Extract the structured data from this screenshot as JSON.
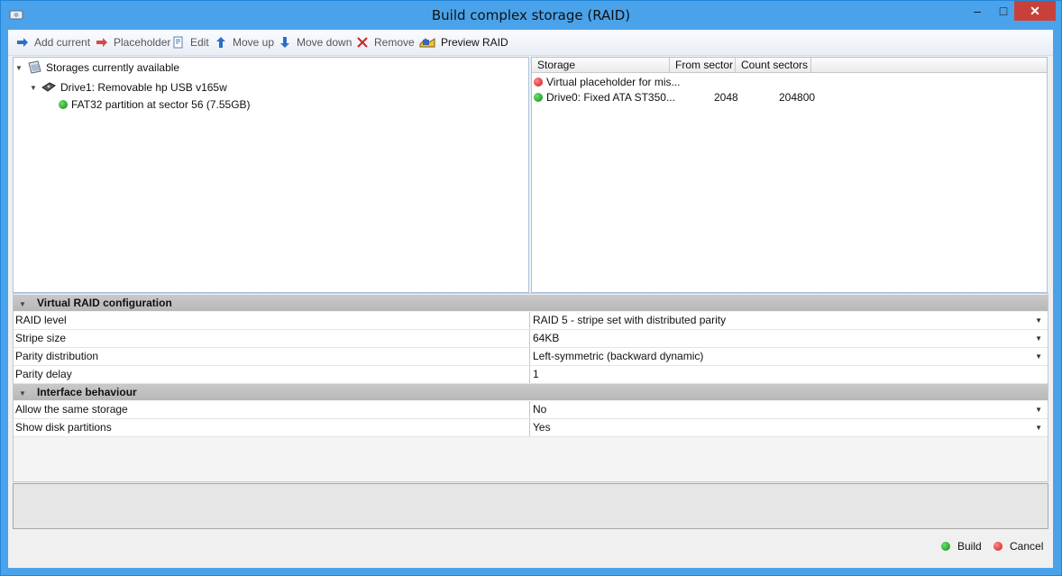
{
  "window": {
    "title": "Build complex storage (RAID)",
    "minimize": "–",
    "maximize": "□",
    "close": "✕"
  },
  "toolbar": {
    "add_current": "Add current",
    "placeholder": "Placeholder",
    "edit": "Edit",
    "move_up": "Move up",
    "move_down": "Move down",
    "remove": "Remove",
    "preview": "Preview RAID"
  },
  "tree": {
    "root": "Storages currently available",
    "drive": "Drive1: Removable hp USB v165w",
    "partition": "FAT32 partition at sector 56 (7.55GB)"
  },
  "list": {
    "columns": [
      "Storage",
      "From sector",
      "Count sectors"
    ],
    "rows": [
      {
        "status": "red",
        "storage": "Virtual placeholder for mis...",
        "from": "",
        "count": ""
      },
      {
        "status": "green",
        "storage": "Drive0: Fixed ATA ST350...",
        "from": "2048",
        "count": "204800"
      }
    ]
  },
  "properties": {
    "raid_category": "Virtual RAID configuration",
    "raid_level_label": "RAID level",
    "raid_level_value": "RAID 5 - stripe set with distributed parity",
    "stripe_size_label": "Stripe size",
    "stripe_size_value": "64KB",
    "parity_dist_label": "Parity distribution",
    "parity_dist_value": "Left-symmetric (backward dynamic)",
    "parity_delay_label": "Parity delay",
    "parity_delay_value": "1",
    "interface_category": "Interface behaviour",
    "same_storage_label": "Allow the same storage",
    "same_storage_value": "No",
    "show_partitions_label": "Show disk partitions",
    "show_partitions_value": "Yes"
  },
  "buttons": {
    "build": "Build",
    "cancel": "Cancel"
  },
  "colors": {
    "title_bar": "#4aa3ea",
    "close_button": "#c7413a",
    "ok": "#0a8a0a",
    "error": "#d21414"
  }
}
